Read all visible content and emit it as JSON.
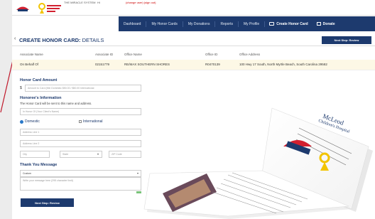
{
  "topbar": {
    "system_label": "THE MIRACLE SYSTEM",
    "greeting": "Hi",
    "user_link": "(change user) (sign out)"
  },
  "nav": {
    "items": [
      "Dashboard",
      "My Honor Cards",
      "My Donations",
      "Reports",
      "My Profile"
    ],
    "create_label": "Create Honor Card",
    "donate_label": "Donate"
  },
  "page": {
    "back_icon": "chevron-left-icon",
    "title_bold": "CREATE HONOR CARD:",
    "title_rest": " DETAILS",
    "next_button": "Next Step: Review"
  },
  "table": {
    "headers": [
      "Associate Name",
      "Associate ID",
      "Office Name",
      "Office ID",
      "Office Address"
    ],
    "row": [
      "On Behalf Of",
      "02151779",
      "RE/MAX SOUTHERN SHORES",
      "R0470139",
      "100 Hwy 17 South, North Myrtle Beach, South Carolina 29582"
    ]
  },
  "form": {
    "amount_title": "Honor Card Amount",
    "currency": "$",
    "amount_placeholder": "Amount to Card (Min Domestic $50.00 / $50.00 International",
    "honoree_title": "Honoree's Information",
    "honoree_sub": "The Honor Card will be sent to this name and address.",
    "name_placeholder": "In Honor Of (Your Client's Name)",
    "domestic_label": "Domestic",
    "international_label": "International",
    "address1_placeholder": "Address Line 1",
    "address2_placeholder": "Address Line 2",
    "city_placeholder": "City",
    "state_placeholder": "State",
    "zip_placeholder": "ZIP Code",
    "message_title": "Thank You Message",
    "message_select": "Custom",
    "message_placeholder": "Write your message here (295 character limit)"
  },
  "card": {
    "title_line1": "McLeod",
    "title_line2": "Children's Hospital"
  },
  "colors": {
    "navy": "#1d3a6e",
    "highlight_row": "#fdf8e6",
    "radio_active": "#2a78c8",
    "red_line": "#c0182a"
  }
}
